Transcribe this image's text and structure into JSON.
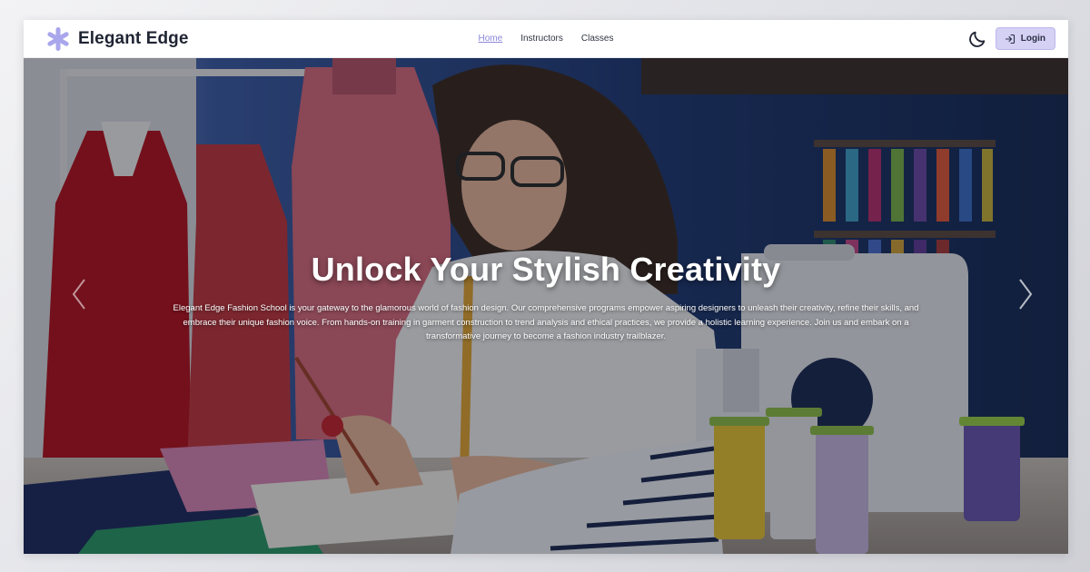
{
  "navbar": {
    "brand_name": "Elegant Edge",
    "brand_icon": "flower-asterisk-icon",
    "links": [
      {
        "label": "Home",
        "active": true
      },
      {
        "label": "Instructors",
        "active": false
      },
      {
        "label": "Classes",
        "active": false
      }
    ],
    "theme_icon": "moon-icon",
    "login_label": "Login",
    "login_icon": "login-arrow-icon"
  },
  "hero": {
    "title": "Unlock Your Stylish Creativity",
    "description": "Elegant Edge Fashion School is your gateway to the glamorous world of fashion design. Our comprehensive programs empower aspiring designers to unleash their creativity, refine their skills, and embrace their unique fashion voice. From hands-on training in garment construction to trend analysis and ethical practices, we provide a holistic learning experience. Join us and embark on a transformative journey to become a fashion industry trailblazer.",
    "prev_icon": "chevron-left-icon",
    "next_icon": "chevron-right-icon"
  },
  "colors": {
    "accent": "#8b87d9",
    "login_bg": "#d4d1f4",
    "logo": "#a9a6ec",
    "nav_text": "#2f3442"
  }
}
